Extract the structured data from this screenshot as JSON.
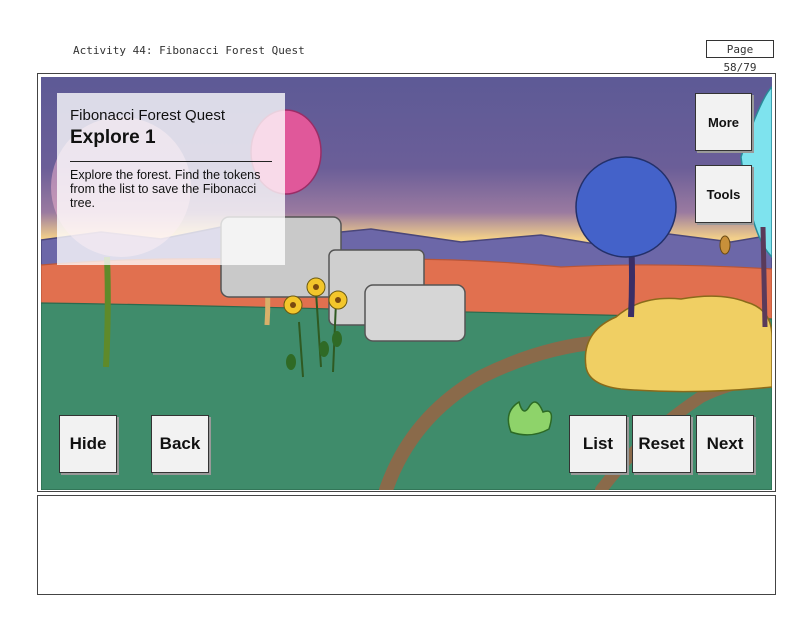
{
  "header": {
    "title": "Activity 44: Fibonacci Forest Quest",
    "page": "Page 58/79"
  },
  "panel": {
    "subtitle": "Fibonacci Forest Quest",
    "title": "Explore 1",
    "description": "Explore the forest. Find the tokens from the list to save the Fibonacci tree."
  },
  "buttons": {
    "more": "More",
    "tools": "Tools",
    "hide": "Hide",
    "back": "Back",
    "list": "List",
    "reset": "Reset",
    "next": "Next"
  },
  "colors": {
    "sky_top": "#5e5a96",
    "sky_glow": "#f2cf8a",
    "mountains": "#6c67a8",
    "orange_ground": "#e1704f",
    "grass": "#3f8c6b",
    "path": "#8a6a4a",
    "bush": "#f0cf63",
    "tree_blue": "#4462c9",
    "tree_pink": "#e0589a",
    "tree_cyan": "#7ee3ee"
  }
}
